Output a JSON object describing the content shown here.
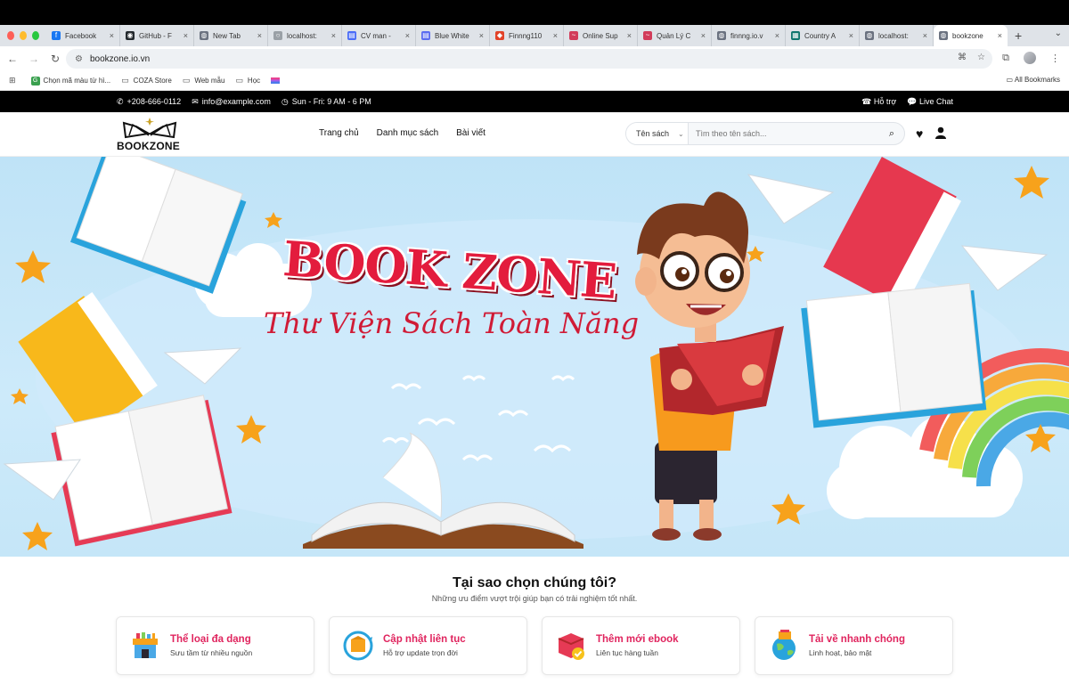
{
  "browser": {
    "tabs": [
      {
        "label": "Facebook",
        "color": "#1877f2",
        "glyph": "f"
      },
      {
        "label": "GitHub - F",
        "color": "#24292e",
        "glyph": "◉"
      },
      {
        "label": "New Tab",
        "color": "#6b7280",
        "glyph": "◍"
      },
      {
        "label": "localhost:",
        "color": "#9aa0a6",
        "glyph": "○"
      },
      {
        "label": "CV man -",
        "color": "#4a6cf7",
        "glyph": "▤"
      },
      {
        "label": "Blue White",
        "color": "#5b6cf0",
        "glyph": "▤"
      },
      {
        "label": "Finnng110",
        "color": "#e24329",
        "glyph": "◆"
      },
      {
        "label": "Online Sup",
        "color": "#d23c5a",
        "glyph": "~"
      },
      {
        "label": "Quản Lý C",
        "color": "#d23c5a",
        "glyph": "~"
      },
      {
        "label": "finnng.io.v",
        "color": "#6b7280",
        "glyph": "◍"
      },
      {
        "label": "Country A",
        "color": "#0f766e",
        "glyph": "▦"
      },
      {
        "label": "localhost:",
        "color": "#6b7280",
        "glyph": "◍"
      },
      {
        "label": "bookzone",
        "color": "#6b7280",
        "glyph": "◍"
      }
    ],
    "url": "bookzone.io.vn",
    "bookmarks": [
      {
        "label": "Chọn mã màu từ hì..."
      },
      {
        "label": "COZA Store"
      },
      {
        "label": "Web mẫu"
      },
      {
        "label": "Học"
      }
    ],
    "all_bookmarks": "All Bookmarks"
  },
  "infobar": {
    "phone": "+208-666-0112",
    "email": "info@example.com",
    "hours": "Sun - Fri: 9 AM - 6 PM",
    "support": "Hỗ trợ",
    "live_chat": "Live Chat"
  },
  "header": {
    "logo_text": "BOOKZONE",
    "nav": [
      "Trang chủ",
      "Danh mục sách",
      "Bài viết"
    ],
    "search_type": "Tên sách",
    "search_placeholder": "Tìm theo tên sách..."
  },
  "hero": {
    "title": "BOOK ZONE",
    "subtitle": "Thư Viện Sách Toàn Năng"
  },
  "why": {
    "title": "Tại sao chọn chúng tôi?",
    "subtitle": "Những ưu điểm vượt trội giúp bạn có trải nghiệm tốt nhất.",
    "features": [
      {
        "title": "Thể loại đa dạng",
        "desc": "Sưu tầm từ nhiều nguồn"
      },
      {
        "title": "Cập nhật liên tục",
        "desc": "Hỗ trợ update trọn đời"
      },
      {
        "title": "Thêm mới ebook",
        "desc": "Liên tục hàng tuần"
      },
      {
        "title": "Tải về nhanh chóng",
        "desc": "Linh hoạt, bảo mật"
      }
    ]
  }
}
